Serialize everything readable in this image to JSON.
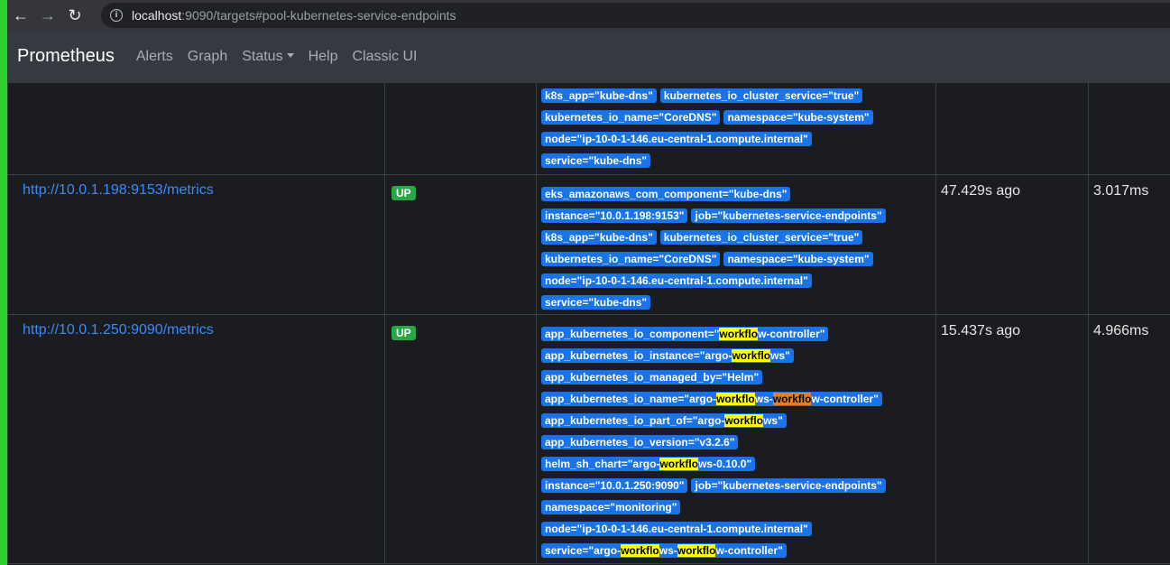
{
  "browser": {
    "url_host": "localhost",
    "url_rest": ":9090/targets#pool-kubernetes-service-endpoints"
  },
  "navbar": {
    "brand": "Prometheus",
    "links": [
      "Alerts",
      "Graph",
      "Status",
      "Help",
      "Classic UI"
    ]
  },
  "partial_row": {
    "labels": [
      [
        {
          "t": "k8s_app=\"kube-dns\""
        },
        {
          "t": "kubernetes_io_cluster_service=\"true\""
        }
      ],
      [
        {
          "t": "kubernetes_io_name=\"CoreDNS\""
        },
        {
          "t": "namespace=\"kube-system\""
        }
      ],
      [
        {
          "t": "node=\"ip-10-0-1-146.eu-central-1.compute.internal\""
        }
      ],
      [
        {
          "t": "service=\"kube-dns\""
        }
      ]
    ]
  },
  "rows": [
    {
      "endpoint": "http://10.0.1.198:9153/metrics",
      "state": "UP",
      "last_scrape": "47.429s ago",
      "duration": "3.017ms",
      "labels": [
        [
          "eks_amazonaws_com_component=\"kube-dns\""
        ],
        [
          "instance=\"10.0.1.198:9153\"",
          "job=\"kubernetes-service-endpoints\""
        ],
        [
          "k8s_app=\"kube-dns\"",
          "kubernetes_io_cluster_service=\"true\""
        ],
        [
          "kubernetes_io_name=\"CoreDNS\"",
          "namespace=\"kube-system\""
        ],
        [
          "node=\"ip-10-0-1-146.eu-central-1.compute.internal\""
        ],
        [
          "service=\"kube-dns\""
        ]
      ]
    },
    {
      "endpoint": "http://10.0.1.250:9090/metrics",
      "state": "UP",
      "last_scrape": "15.437s ago",
      "duration": "4.966ms",
      "labels": [
        [
          "app_kubernetes_io_component=\"workflow-controller\""
        ],
        [
          "app_kubernetes_io_instance=\"argo-workflows\""
        ],
        [
          "app_kubernetes_io_managed_by=\"Helm\""
        ],
        [
          "app_kubernetes_io_name=\"argo-workflows-workflow-controller\""
        ],
        [
          "app_kubernetes_io_part_of=\"argo-workflows\""
        ],
        [
          "app_kubernetes_io_version=\"v3.2.6\""
        ],
        [
          "helm_sh_chart=\"argo-workflows-0.10.0\""
        ],
        [
          "instance=\"10.0.1.250:9090\"",
          "job=\"kubernetes-service-endpoints\""
        ],
        [
          "namespace=\"monitoring\""
        ],
        [
          "node=\"ip-10-0-1-146.eu-central-1.compute.internal\""
        ],
        [
          "service=\"argo-workflows-workflow-controller\""
        ]
      ]
    }
  ],
  "search_highlight": "workflo",
  "colors": {
    "label_bg": "#1a73e8",
    "up_badge": "#28a745",
    "highlight": "#ffff00",
    "highlight_active": "#e67e22"
  }
}
